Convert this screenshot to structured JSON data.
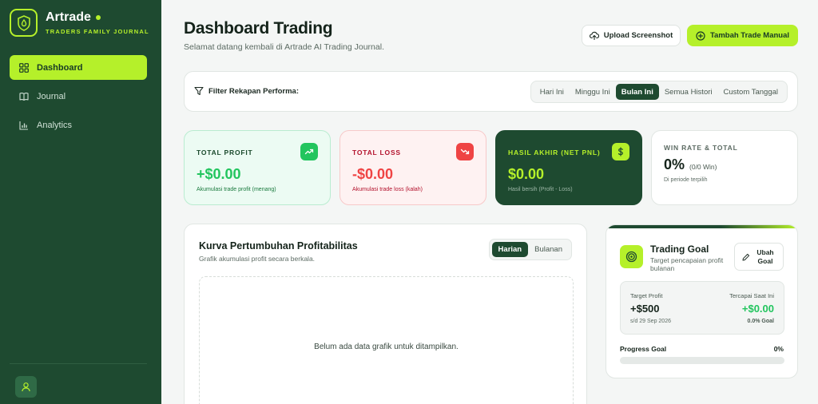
{
  "brand": {
    "name": "Artrade",
    "tagline": "TRADERS FAMILY JOURNAL"
  },
  "sidebar": {
    "items": [
      {
        "label": "Dashboard",
        "icon": "grid-icon",
        "active": true
      },
      {
        "label": "Journal",
        "icon": "book-icon",
        "active": false
      },
      {
        "label": "Analytics",
        "icon": "bar-chart-icon",
        "active": false
      }
    ]
  },
  "header": {
    "title": "Dashboard Trading",
    "subtitle": "Selamat datang kembali di Artrade AI Trading Journal.",
    "upload_label": "Upload Screenshot",
    "add_label": "Tambah Trade Manual"
  },
  "filter": {
    "label": "Filter Rekapan Performa:",
    "tabs": [
      "Hari Ini",
      "Minggu Ini",
      "Bulan Ini",
      "Semua Histori",
      "Custom Tanggal"
    ],
    "active": "Bulan Ini"
  },
  "stats": {
    "profit": {
      "label": "TOTAL PROFIT",
      "value": "+$0.00",
      "note": "Akumulasi trade profit (menang)"
    },
    "loss": {
      "label": "TOTAL LOSS",
      "value": "-$0.00",
      "note": "Akumulasi trade loss (kalah)"
    },
    "net": {
      "label": "HASIL AKHIR (NET PNL)",
      "value": "$0.00",
      "note": "Hasil bersih (Profit - Loss)"
    },
    "winrate": {
      "label": "WIN RATE & TOTAL",
      "value": "0%",
      "count": "(0/0 Win)",
      "note": "Di periode terpilih"
    }
  },
  "chart_panel": {
    "title": "Kurva Pertumbuhan Profitabilitas",
    "subtitle": "Grafik akumulasi profit secara berkala.",
    "toggle": [
      "Harian",
      "Bulanan"
    ],
    "active": "Harian",
    "empty_text": "Belum ada data grafik untuk ditampilkan."
  },
  "goal": {
    "title": "Trading Goal",
    "subtitle": "Target pencapaian profit bulanan",
    "edit_label": "Ubah Goal",
    "target_label": "Target Profit",
    "target_value": "+$500",
    "target_date": "s/d 29 Sep 2026",
    "achieved_label": "Tercapai Saat Ini",
    "achieved_value": "+$0.00",
    "achieved_pct": "0.0% Goal",
    "progress_label": "Progress Goal",
    "progress_text": "0%",
    "progress_value": 0
  },
  "colors": {
    "sidebar": "#1e4a30",
    "accent": "#b5f02a",
    "profit": "#22c55e",
    "loss": "#ef4444"
  }
}
